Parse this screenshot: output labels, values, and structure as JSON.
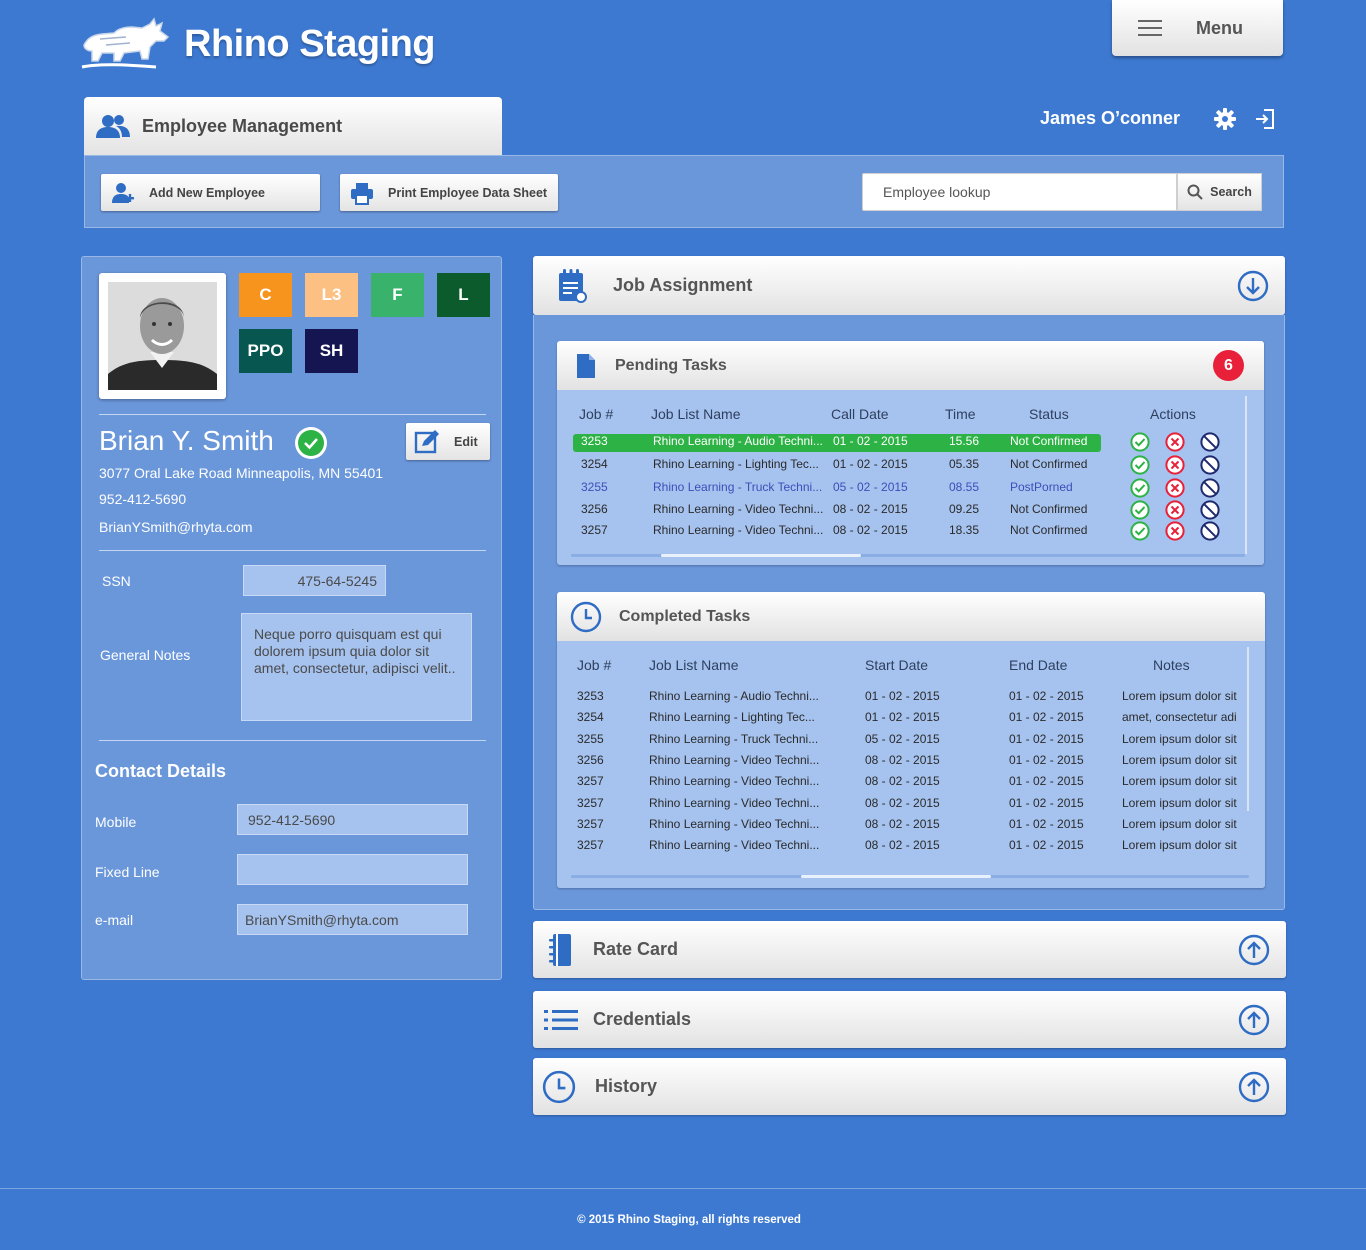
{
  "app": {
    "title": "Rhino Staging",
    "menu_label": "Menu"
  },
  "header": {
    "section_tab": "Employee Management",
    "user_name": "James O’conner"
  },
  "toolbar": {
    "add_employee": "Add New Employee",
    "print_sheet": "Print Employee Data Sheet",
    "search_placeholder": "Employee lookup",
    "search_label": "Search"
  },
  "profile": {
    "tags": [
      {
        "label": "C",
        "color": "#f7941d",
        "text_color": "#ffffff"
      },
      {
        "label": "L3",
        "color": "#fcc083",
        "text_color": "#ffffff"
      },
      {
        "label": "F",
        "color": "#39b36b",
        "text_color": "#ffffff"
      },
      {
        "label": "L",
        "color": "#0b5b2c",
        "text_color": "#ffffff"
      },
      {
        "label": "PPO",
        "color": "#075750",
        "text_color": "#ffffff"
      },
      {
        "label": "SH",
        "color": "#151552",
        "text_color": "#ffffff"
      }
    ],
    "name": "Brian Y. Smith",
    "edit_label": "Edit",
    "address": "3077 Oral Lake Road Minneapolis, MN 55401",
    "phone": "952-412-5690",
    "email": "BrianYSmith@rhyta.com",
    "ssn_label": "SSN",
    "ssn_value": "475-64-5245",
    "notes_label": "General Notes",
    "notes_value": "Neque porro quisquam est qui dolorem ipsum quia dolor sit amet, consectetur, adipisci velit.."
  },
  "contact": {
    "title": "Contact Details",
    "mobile_label": "Mobile",
    "mobile_value": "952-412-5690",
    "fixed_label": "Fixed Line",
    "fixed_value": "",
    "email_label": "e-mail",
    "email_value": "BrianYSmith@rhyta.com"
  },
  "job_assignment": {
    "title": "Job Assignment",
    "pending": {
      "title": "Pending Tasks",
      "count": "6",
      "headers": [
        "Job #",
        "Job List Name",
        "Call  Date",
        "Time",
        "Status",
        "Actions"
      ],
      "rows": [
        {
          "job": "3253",
          "name": "Rhino Learning - Audio Techni...",
          "date": "01 - 02 - 2015",
          "time": "15.56",
          "status": "Not Confirmed",
          "style": "highlight"
        },
        {
          "job": "3254",
          "name": "Rhino Learning - Lighting Tec...",
          "date": "01 - 02 - 2015",
          "time": "05.35",
          "status": "Not Confirmed",
          "style": "normal"
        },
        {
          "job": "3255",
          "name": "Rhino Learning -  Truck Techni...",
          "date": "05 - 02 - 2015",
          "time": "08.55",
          "status": "PostPorned",
          "style": "postponed"
        },
        {
          "job": "3256",
          "name": "Rhino Learning - Video Techni...",
          "date": "08 - 02 - 2015",
          "time": "09.25",
          "status": "Not Confirmed",
          "style": "normal"
        },
        {
          "job": "3257",
          "name": "Rhino Learning - Video Techni...",
          "date": "08 - 02 - 2015",
          "time": "18.35",
          "status": "Not Confirmed",
          "style": "normal"
        }
      ]
    },
    "completed": {
      "title": "Completed Tasks",
      "headers": [
        "Job #",
        "Job List Name",
        "Start Date",
        "End Date",
        "Notes"
      ],
      "rows": [
        {
          "job": "3253",
          "name": "Rhino Learning - Audio Techni...",
          "start": "01 - 02 - 2015",
          "end": "01 - 02 - 2015",
          "notes": "Lorem ipsum dolor sit"
        },
        {
          "job": "3254",
          "name": "Rhino Learning - Lighting Tec...",
          "start": "01 - 02 - 2015",
          "end": "01 - 02 - 2015",
          "notes": "amet, consectetur adi"
        },
        {
          "job": "3255",
          "name": "Rhino Learning -  Truck Techni...",
          "start": "05 - 02 - 2015",
          "end": "01 - 02 - 2015",
          "notes": "Lorem ipsum dolor sit"
        },
        {
          "job": "3256",
          "name": "Rhino Learning - Video Techni...",
          "start": "08 - 02 - 2015",
          "end": "01 - 02 - 2015",
          "notes": "Lorem ipsum dolor sit"
        },
        {
          "job": "3257",
          "name": "Rhino Learning - Video Techni...",
          "start": "08 - 02 - 2015",
          "end": "01 - 02 - 2015",
          "notes": "Lorem ipsum dolor sit"
        },
        {
          "job": "3257",
          "name": "Rhino Learning - Video Techni...",
          "start": "08 - 02 - 2015",
          "end": "01 - 02 - 2015",
          "notes": "Lorem ipsum dolor sit"
        },
        {
          "job": "3257",
          "name": "Rhino Learning - Video Techni...",
          "start": "08 - 02 - 2015",
          "end": "01 - 02 - 2015",
          "notes": "Lorem ipsum dolor sit"
        },
        {
          "job": "3257",
          "name": "Rhino Learning - Video Techni...",
          "start": "08 - 02 - 2015",
          "end": "01 - 02 - 2015",
          "notes": "Lorem ipsum dolor sit"
        }
      ]
    }
  },
  "sections": {
    "rate_card": "Rate Card",
    "credentials": "Credentials",
    "history": "History"
  },
  "footer": {
    "copyright": "© 2015 Rhino Staging, all rights reserved"
  },
  "icons": {
    "logo": "rhino-logo-icon",
    "menu": "hamburger-icon",
    "employees": "users-icon",
    "settings": "gear-icon",
    "logout": "logout-icon",
    "add": "add-user-icon",
    "print": "printer-icon",
    "search": "search-icon",
    "edit": "edit-icon",
    "verified": "check-circle-icon",
    "confirm": "check-circle-icon",
    "reject": "x-circle-icon",
    "block": "ban-icon",
    "expand": "arrow-down-circle-icon",
    "collapse": "arrow-up-circle-icon"
  },
  "colors": {
    "background": "#3d79d1",
    "panel": "#6a96da",
    "field": "#a6c3ef",
    "accent_blue": "#2f6cc4",
    "highlight_row": "#2cb245",
    "badge": "#e8203a",
    "confirm": "#2cb245",
    "reject": "#e8203a",
    "block": "#1f2a6e"
  }
}
